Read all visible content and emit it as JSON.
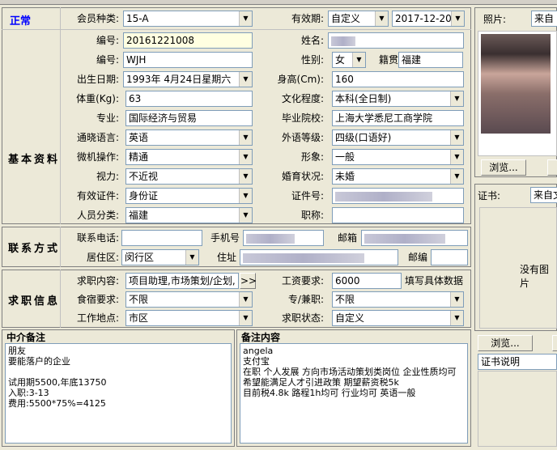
{
  "status": "正常",
  "basic_label": "基本资料",
  "contact_label": "联系方式",
  "job_label": "求职信息",
  "labels": {
    "member_type": "会员种类:",
    "validity": "有效期:",
    "no1": "编号:",
    "name": "姓名:",
    "no2": "编号:",
    "gender": "性别:",
    "native": "籍贯",
    "birth": "出生日期:",
    "height": "身高(Cm):",
    "weight": "体重(Kg):",
    "education": "文化程度:",
    "major": "专业:",
    "school": "毕业院校:",
    "language": "通晓语言:",
    "foreign": "外语等级:",
    "computer": "微机操作:",
    "image": "形象:",
    "vision": "视力:",
    "marital": "婚育状况:",
    "id_doc": "有效证件:",
    "id_no": "证件号:",
    "category": "人员分类:",
    "title": "职称:",
    "phone": "联系电话:",
    "mobile": "手机号",
    "email": "邮箱",
    "district": "居住区:",
    "address": "住址",
    "postcode": "邮编",
    "job_content": "求职内容:",
    "salary": "工资要求:",
    "salary_note": "填写具体数据",
    "board": "食宿要求:",
    "parttime": "专/兼职:",
    "location": "工作地点:",
    "job_status": "求职状态:",
    "photo": "照片:",
    "cert": "证书:"
  },
  "values": {
    "member_type": "15-A",
    "validity_type": "自定义",
    "validity_date": "2017-12-20",
    "no1": "20161221008",
    "no2": "WJH",
    "gender": "女",
    "native": "福建",
    "birth": "1993年 4月24日星期六",
    "height": "160",
    "weight": "63",
    "education": "本科(全日制)",
    "major": "国际经济与贸易",
    "school": "上海大学悉尼工商学院",
    "language": "英语",
    "foreign": "四级(口语好)",
    "computer": "精通",
    "image": "一般",
    "vision": "不近视",
    "marital": "未婚",
    "id_doc": "身份证",
    "category": "福建",
    "district": "闵行区",
    "job_content": "项目助理,市场策划/企划,",
    "salary": "6000",
    "board": "不限",
    "parttime": "不限",
    "location": "市区",
    "job_status": "自定义"
  },
  "photo_source": "来自",
  "cert_source": "来自文",
  "browse": "浏览...",
  "no_image": "没有图片",
  "cert_desc": "证书说明",
  "more_btn": ">>",
  "intermediary": {
    "title": "中介备注",
    "lines": [
      "朋友",
      "要能落户的企业",
      "",
      "试用期5500,年底13750",
      "入职:3-13",
      "费用:5500*75%=4125"
    ]
  },
  "notes": {
    "title": "备注内容",
    "lines": [
      "angela",
      "支付宝",
      "在职 个人发展 方向市场活动策划类岗位 企业性质均可 希望能满足人才引进政策 期望薪资税5k",
      "目前税4.8k 路程1h均可 行业均可 英语一般"
    ]
  }
}
